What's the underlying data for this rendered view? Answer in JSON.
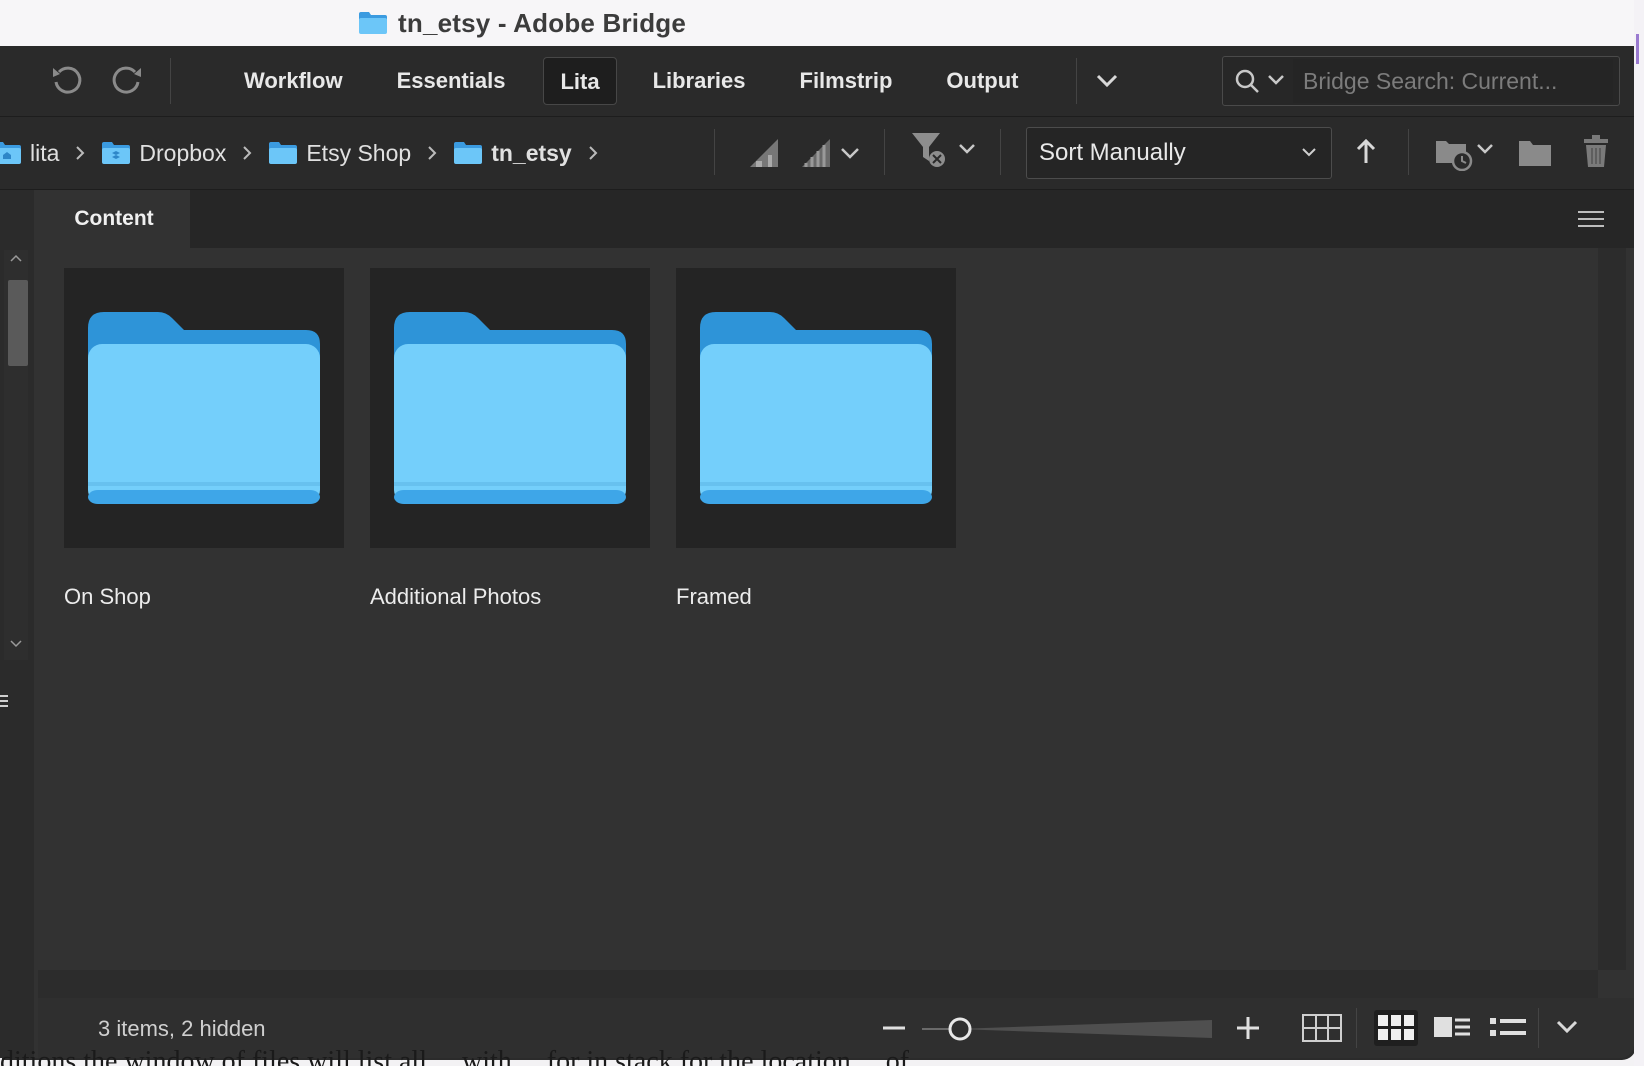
{
  "window": {
    "title": "tn_etsy - Adobe Bridge"
  },
  "toolbar": {
    "undo_icon": "undo-icon",
    "redo_icon": "redo-icon",
    "workspaces": [
      "Workflow",
      "Essentials",
      "Lita",
      "Libraries",
      "Filmstrip",
      "Output"
    ],
    "active_workspace": "Lita",
    "more_icon": "chevron-down-icon",
    "search": {
      "placeholder": "Bridge Search: Current...",
      "value": ""
    }
  },
  "pathbar": {
    "crumbs": [
      {
        "label": "lita",
        "icon": "home-folder-icon"
      },
      {
        "label": "Dropbox",
        "icon": "dropbox-folder-icon"
      },
      {
        "label": "Etsy Shop",
        "icon": "folder-icon"
      },
      {
        "label": "tn_etsy",
        "icon": "folder-icon"
      }
    ],
    "sort": {
      "selected": "Sort Manually"
    }
  },
  "panel": {
    "tab": "Content",
    "items": [
      {
        "label": "On Shop"
      },
      {
        "label": "Additional Photos"
      },
      {
        "label": "Framed"
      }
    ]
  },
  "status": {
    "text": "3 items, 2 hidden",
    "zoom_fraction": 0.1
  },
  "colors": {
    "folder_front": "#74CFFB",
    "folder_back": "#2E94D8",
    "window_bg": "#323232",
    "toolbar_bg": "#2A2A2A"
  },
  "underlying_text": "ditions the window of files will list all ... with ... for in stack for the location ... of"
}
